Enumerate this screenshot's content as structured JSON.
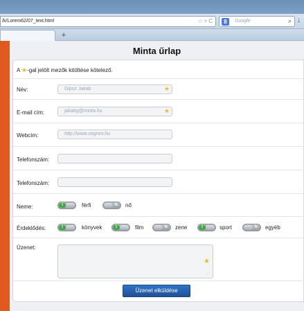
{
  "browser": {
    "url": "/k/Lorem62/07_text.html",
    "search_placeholder": "Google",
    "new_tab_symbol": "+",
    "search_engine_letter": "8"
  },
  "page": {
    "title": "Minta űrlap",
    "required_note_prefix": "A",
    "required_note_suffix": "-gal jelölt mezők kitöltése kötelező."
  },
  "form": {
    "name": {
      "label": "Név:",
      "placeholder": "Gipsz Jakab",
      "required": true
    },
    "email": {
      "label": "E-mail cím:",
      "placeholder": "jakabg@minta.hu",
      "required": true
    },
    "website": {
      "label": "Webcím:",
      "placeholder": "http://www.cegnev.hu"
    },
    "phone1": {
      "label": "Telefonszám:",
      "value": ""
    },
    "phone2": {
      "label": "Telefonszám:",
      "value": ""
    },
    "gender": {
      "label": "Neme:",
      "options": [
        {
          "label": "férfi",
          "on": true,
          "on_text": "I",
          "off_text": ""
        },
        {
          "label": "nő",
          "on": false,
          "on_text": "",
          "off_text": "N"
        }
      ]
    },
    "interests": {
      "label": "Érdeklődés:",
      "options": [
        {
          "label": "könyvek",
          "on": true,
          "on_text": "I"
        },
        {
          "label": "film",
          "on": true,
          "on_text": "I"
        },
        {
          "label": "zene",
          "on": false,
          "off_text": "N"
        },
        {
          "label": "sport",
          "on": true,
          "on_text": "I"
        },
        {
          "label": "egyéb",
          "on": false,
          "off_text": "N"
        }
      ]
    },
    "message": {
      "label": "Üzenet:"
    },
    "submit_label": "Üzenet elküldése"
  },
  "colors": {
    "accent": "#2f74c7",
    "required_star": "#e9b82c",
    "toggle_on": "#41a847",
    "browser_edge": "#e05a1f"
  }
}
